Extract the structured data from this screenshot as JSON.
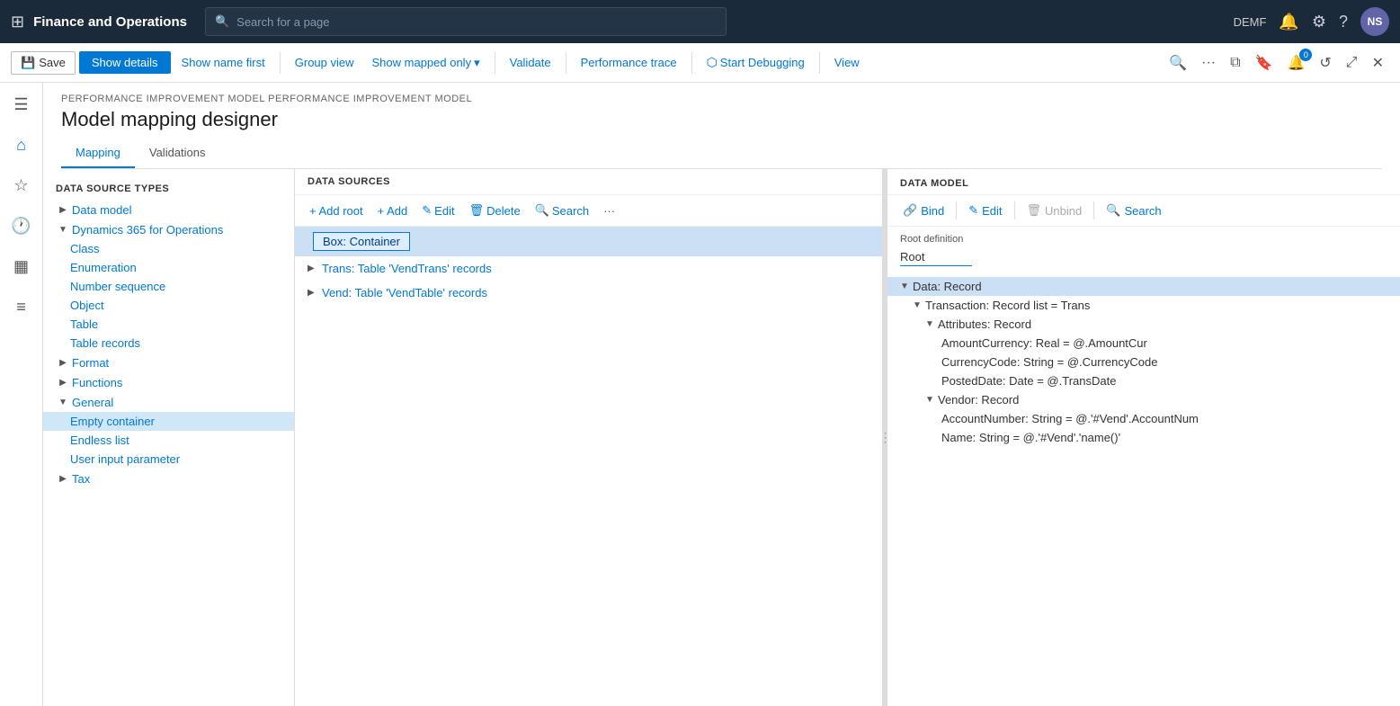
{
  "topNav": {
    "appTitle": "Finance and Operations",
    "searchPlaceholder": "Search for a page",
    "userInitials": "NS",
    "userRegion": "DEMF"
  },
  "toolbar": {
    "saveLabel": "Save",
    "showDetailsLabel": "Show details",
    "showNameFirstLabel": "Show name first",
    "groupViewLabel": "Group view",
    "showMappedOnlyLabel": "Show mapped only",
    "validateLabel": "Validate",
    "performanceTraceLabel": "Performance trace",
    "startDebuggingLabel": "Start Debugging",
    "viewLabel": "View"
  },
  "page": {
    "breadcrumb": "PERFORMANCE IMPROVEMENT MODEL  PERFORMANCE IMPROVEMENT MODEL",
    "title": "Model mapping designer",
    "tabs": [
      "Mapping",
      "Validations"
    ]
  },
  "dataSourceTypes": {
    "header": "DATA SOURCE TYPES",
    "items": [
      {
        "label": "Data model",
        "indent": 0,
        "expanded": false
      },
      {
        "label": "Dynamics 365 for Operations",
        "indent": 0,
        "expanded": true
      },
      {
        "label": "Class",
        "indent": 1,
        "expanded": false
      },
      {
        "label": "Enumeration",
        "indent": 1,
        "expanded": false
      },
      {
        "label": "Number sequence",
        "indent": 1,
        "expanded": false
      },
      {
        "label": "Object",
        "indent": 1,
        "expanded": false
      },
      {
        "label": "Table",
        "indent": 1,
        "expanded": false
      },
      {
        "label": "Table records",
        "indent": 1,
        "expanded": false,
        "selected": false
      },
      {
        "label": "Format",
        "indent": 0,
        "expanded": false
      },
      {
        "label": "Functions",
        "indent": 0,
        "expanded": false
      },
      {
        "label": "General",
        "indent": 0,
        "expanded": true
      },
      {
        "label": "Empty container",
        "indent": 1,
        "expanded": false,
        "selected": true
      },
      {
        "label": "Endless list",
        "indent": 1,
        "expanded": false
      },
      {
        "label": "User input parameter",
        "indent": 1,
        "expanded": false
      },
      {
        "label": "Tax",
        "indent": 0,
        "expanded": false
      }
    ]
  },
  "dataSources": {
    "header": "DATA SOURCES",
    "toolbar": {
      "addRoot": "+ Add root",
      "add": "+ Add",
      "edit": "✎ Edit",
      "delete": "🗑 Delete",
      "search": "🔍 Search",
      "more": "···"
    },
    "items": [
      {
        "label": "Box: Container",
        "indent": 0,
        "selected": true
      },
      {
        "label": "Trans: Table 'VendTrans' records",
        "indent": 0,
        "expanded": false
      },
      {
        "label": "Vend: Table 'VendTable' records",
        "indent": 0,
        "expanded": false
      }
    ]
  },
  "dataModel": {
    "header": "DATA MODEL",
    "toolbar": {
      "bind": "Bind",
      "edit": "Edit",
      "unbind": "Unbind",
      "search": "Search"
    },
    "rootDefinitionLabel": "Root definition",
    "rootDefinitionValue": "Root",
    "tree": [
      {
        "label": "Data: Record",
        "indent": 0,
        "expanded": true,
        "selected": true
      },
      {
        "label": "Transaction: Record list = Trans",
        "indent": 1,
        "expanded": true
      },
      {
        "label": "Attributes: Record",
        "indent": 2,
        "expanded": true
      },
      {
        "label": "AmountCurrency: Real = @.AmountCur",
        "indent": 3
      },
      {
        "label": "CurrencyCode: String = @.CurrencyCode",
        "indent": 3
      },
      {
        "label": "PostedDate: Date = @.TransDate",
        "indent": 3
      },
      {
        "label": "Vendor: Record",
        "indent": 2,
        "expanded": true
      },
      {
        "label": "AccountNumber: String = @.'#Vend'.AccountNum",
        "indent": 3
      },
      {
        "label": "Name: String = @.'#Vend'.'name()'",
        "indent": 3
      }
    ]
  }
}
